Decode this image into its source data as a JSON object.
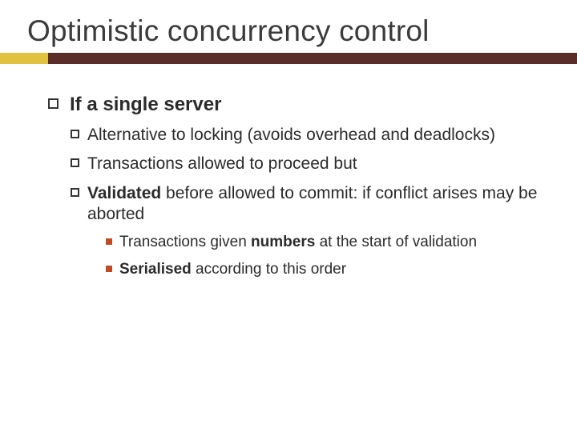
{
  "title": "Optimistic concurrency control",
  "points": [
    {
      "text": "If a single server",
      "children": [
        {
          "runs": [
            "Alternative",
            " to locking (avoids overhead and deadlocks)"
          ]
        },
        {
          "runs": [
            "Transactions",
            " allowed to proceed but"
          ]
        },
        {
          "runs": [
            "Validated",
            " before allowed to commit: if conflict arises may be aborted"
          ],
          "children": [
            {
              "runs": [
                "Transactions given ",
                "numbers",
                " at the start of validation"
              ]
            },
            {
              "runs": [
                "Serialised",
                " according to this order"
              ]
            }
          ]
        }
      ]
    }
  ]
}
